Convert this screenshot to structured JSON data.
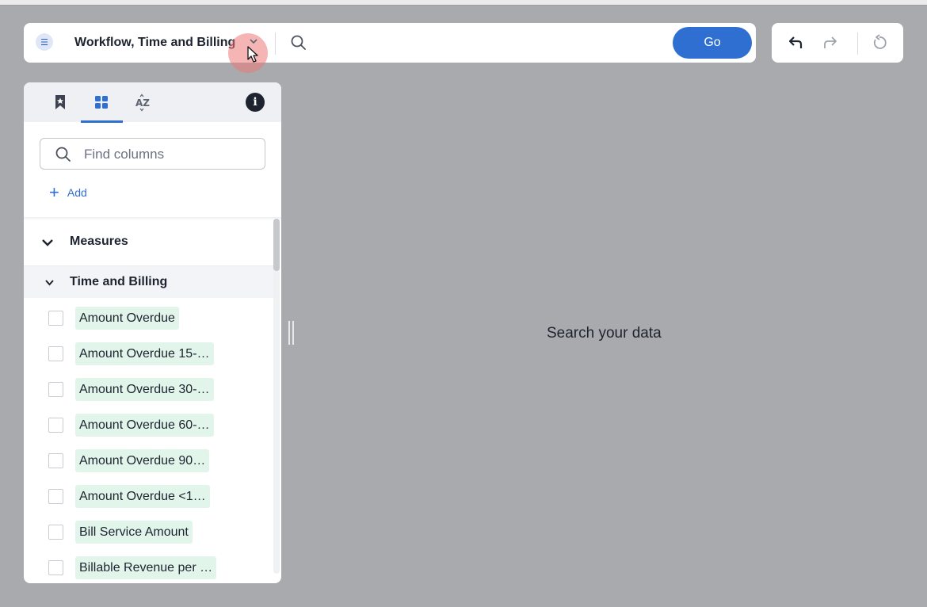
{
  "searchbar": {
    "datasource_name": "Workflow, Time and Billing",
    "go_label": "Go",
    "datasource_icon": "list-icon"
  },
  "history": {
    "undo_icon": "undo-icon",
    "redo_icon": "redo-icon",
    "reset_icon": "reset-icon"
  },
  "panel": {
    "tabs": [
      {
        "icon": "bookmark-icon"
      },
      {
        "icon": "grid-icon",
        "active": true
      },
      {
        "icon": "sort-az-icon"
      }
    ],
    "info_glyph": "i",
    "find_placeholder": "Find columns",
    "add_label": "Add",
    "section_label": "Measures",
    "group_label": "Time and Billing",
    "columns": [
      "Amount Overdue",
      "Amount Overdue 15-…",
      "Amount Overdue 30-…",
      "Amount Overdue 60-…",
      "Amount Overdue 90…",
      "Amount Overdue <1…",
      "Bill Service Amount",
      "Billable Revenue per …"
    ]
  },
  "main": {
    "empty_message": "Search your data"
  },
  "colors": {
    "accent": "#2f6fd1",
    "pill_bg": "#e2f5ea",
    "backdrop": "#a9aaad"
  }
}
